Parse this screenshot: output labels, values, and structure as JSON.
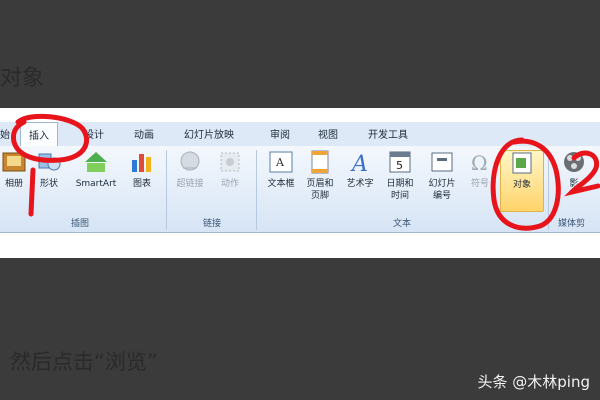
{
  "heading_top": "对象",
  "instruction": "然后点击“浏览”",
  "watermark": "头条 @木林ping",
  "ribbon": {
    "tabs": [
      "始",
      "插入",
      "设计",
      "动画",
      "幻灯片放映",
      "审阅",
      "视图",
      "开发工具"
    ],
    "active_tab": "插入",
    "groups": {
      "illustrations": {
        "title": "插图",
        "buttons": [
          "相册",
          "形状",
          "SmartArt",
          "图表"
        ]
      },
      "links": {
        "title": "链接",
        "buttons": [
          "超链接",
          "动作"
        ]
      },
      "text": {
        "title": "文本",
        "buttons": [
          "文本框",
          "页眉和\n页脚",
          "艺术字",
          "日期和\n时间",
          "幻灯片\n编号",
          "符号",
          "对象"
        ]
      },
      "media": {
        "title": "媒体剪",
        "buttons": [
          "影"
        ]
      }
    },
    "highlighted_button": "对象",
    "date_icon_digit": "5"
  },
  "annotations": {
    "num1": "1",
    "num2": "2"
  },
  "colors": {
    "annotation": "#e8141c",
    "ribbon_tab_bg": "#dde9f7",
    "highlight": "#ffd46a"
  }
}
